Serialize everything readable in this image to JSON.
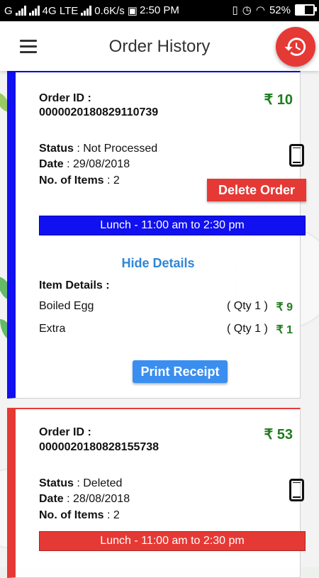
{
  "status_bar": {
    "left_text": "G",
    "network": "4G LTE",
    "speed": "0.6K/s",
    "time": "2:50 PM",
    "battery": "52%",
    "battery_level": 0.52
  },
  "header": {
    "title": "Order History"
  },
  "orders": [
    {
      "id_label": "Order ID :",
      "id": "0000020180829110739",
      "price": "₹ 10",
      "status_label": "Status",
      "status": " : Not Processed",
      "date_label": "Date",
      "date": " : 29/08/2018",
      "items_label": "No. of Items",
      "items": " : 2",
      "delete_label": "Delete Order",
      "slot": "Lunch - 11:00 am to 2:30 pm",
      "hide_details": "Hide Details",
      "item_details_label": "Item Details :",
      "line_items": [
        {
          "name": "Boiled Egg",
          "qty": "( Qty 1 )",
          "price": "₹ 9"
        },
        {
          "name": "Extra",
          "qty": "( Qty 1 )",
          "price": "₹ 1"
        }
      ],
      "print_label": "Print Receipt",
      "accent": "#1010f0"
    },
    {
      "id_label": "Order ID :",
      "id": "0000020180828155738",
      "price": "₹ 53",
      "status_label": "Status",
      "status": " : Deleted",
      "date_label": "Date",
      "date": " : 28/08/2018",
      "items_label": "No. of Items",
      "items": " : 2",
      "slot": "Lunch - 11:00 am to 2:30 pm",
      "accent": "#e53935"
    }
  ],
  "icons": {
    "menu": "hamburger-icon",
    "history": "history-icon",
    "device": "phone-icon"
  },
  "colors": {
    "price_green": "#1e7d1e",
    "fab_red": "#e53935",
    "link_blue": "#2f86d8",
    "print_button": "#3a8ef0"
  }
}
